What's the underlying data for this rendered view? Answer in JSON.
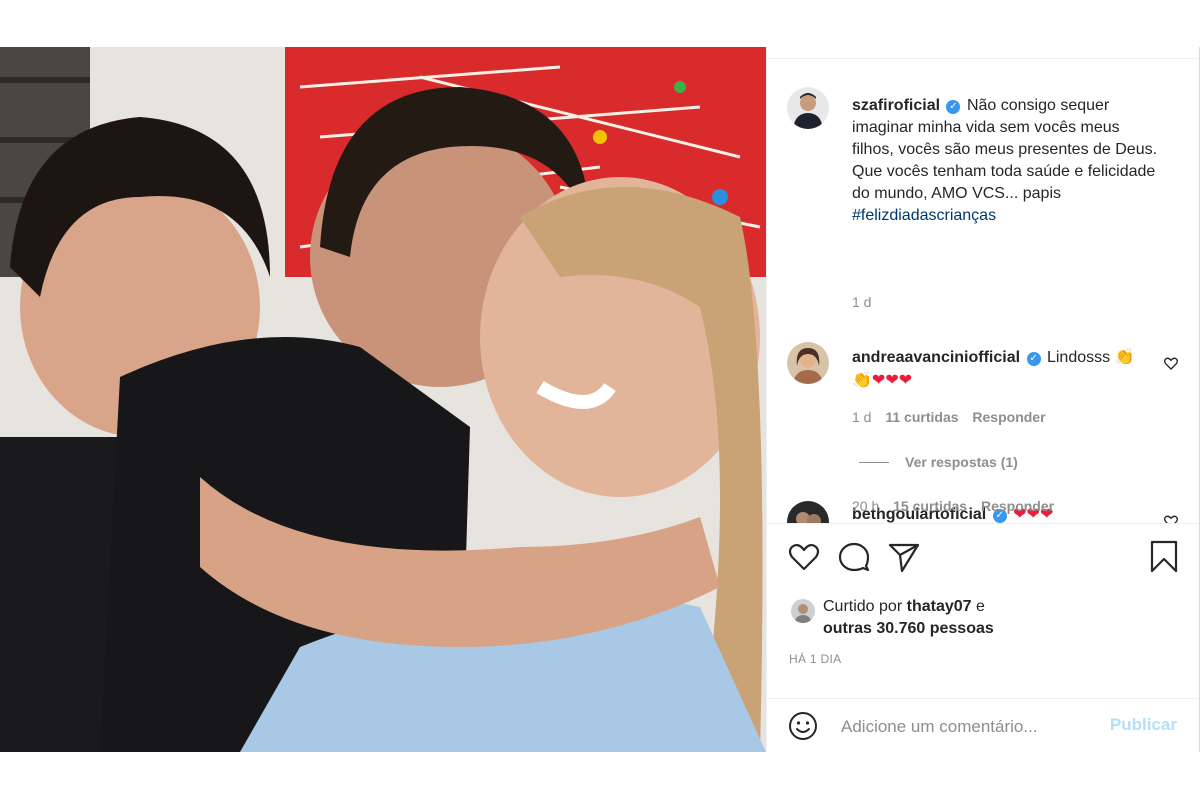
{
  "post": {
    "author": {
      "username": "szafiroficial",
      "verified": true,
      "caption": "Não consigo sequer imaginar minha vida sem vocês meus filhos, vocês são meus presentes de Deus. Que vocês tenham toda saúde e felicidade do mundo, AMO VCS... papis",
      "hashtag": "#felizdiadascrianças",
      "time": "1 d"
    },
    "comments": [
      {
        "username": "andreaavanciniofficial",
        "verified": true,
        "text": "Lindosss",
        "emojis": "👏 ❤ ❤ ❤",
        "time": "1 d",
        "likes": "11 curtidas",
        "reply": "Responder",
        "view_replies": "Ver respostas (1)"
      },
      {
        "username": "bethgoulartoficial",
        "verified": true,
        "text": "",
        "emojis": "❤ ❤ ❤",
        "time": "20 h",
        "likes": "15 curtidas",
        "reply": "Responder"
      }
    ],
    "actions": {
      "like_icon": "heart-outline-icon",
      "comment_icon": "comment-bubble-icon",
      "share_icon": "paper-plane-icon",
      "save_icon": "bookmark-icon"
    },
    "likes": {
      "prefix": "Curtido por",
      "user": "thatay07",
      "connector": "e",
      "others": "outras 30.760 pessoas"
    },
    "timestamp": "HÁ 1 DIA",
    "add_comment": {
      "placeholder": "Adicione um comentário...",
      "publish": "Publicar"
    }
  },
  "colors": {
    "link": "#00376b",
    "muted": "#8e8e8e",
    "publish_disabled": "#b2dffc",
    "heart_red": "#ed1c3b",
    "verified_blue": "#3897f0"
  }
}
